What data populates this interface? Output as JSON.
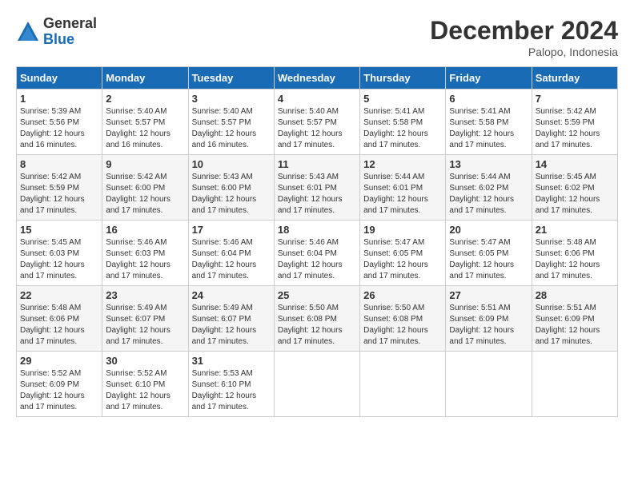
{
  "header": {
    "logo_general": "General",
    "logo_blue": "Blue",
    "month_title": "December 2024",
    "subtitle": "Palopo, Indonesia"
  },
  "days_of_week": [
    "Sunday",
    "Monday",
    "Tuesday",
    "Wednesday",
    "Thursday",
    "Friday",
    "Saturday"
  ],
  "weeks": [
    [
      {
        "day": "1",
        "sunrise": "5:39 AM",
        "sunset": "5:56 PM",
        "daylight": "12 hours and 16 minutes."
      },
      {
        "day": "2",
        "sunrise": "5:40 AM",
        "sunset": "5:57 PM",
        "daylight": "12 hours and 16 minutes."
      },
      {
        "day": "3",
        "sunrise": "5:40 AM",
        "sunset": "5:57 PM",
        "daylight": "12 hours and 16 minutes."
      },
      {
        "day": "4",
        "sunrise": "5:40 AM",
        "sunset": "5:57 PM",
        "daylight": "12 hours and 17 minutes."
      },
      {
        "day": "5",
        "sunrise": "5:41 AM",
        "sunset": "5:58 PM",
        "daylight": "12 hours and 17 minutes."
      },
      {
        "day": "6",
        "sunrise": "5:41 AM",
        "sunset": "5:58 PM",
        "daylight": "12 hours and 17 minutes."
      },
      {
        "day": "7",
        "sunrise": "5:42 AM",
        "sunset": "5:59 PM",
        "daylight": "12 hours and 17 minutes."
      }
    ],
    [
      {
        "day": "8",
        "sunrise": "5:42 AM",
        "sunset": "5:59 PM",
        "daylight": "12 hours and 17 minutes."
      },
      {
        "day": "9",
        "sunrise": "5:42 AM",
        "sunset": "6:00 PM",
        "daylight": "12 hours and 17 minutes."
      },
      {
        "day": "10",
        "sunrise": "5:43 AM",
        "sunset": "6:00 PM",
        "daylight": "12 hours and 17 minutes."
      },
      {
        "day": "11",
        "sunrise": "5:43 AM",
        "sunset": "6:01 PM",
        "daylight": "12 hours and 17 minutes."
      },
      {
        "day": "12",
        "sunrise": "5:44 AM",
        "sunset": "6:01 PM",
        "daylight": "12 hours and 17 minutes."
      },
      {
        "day": "13",
        "sunrise": "5:44 AM",
        "sunset": "6:02 PM",
        "daylight": "12 hours and 17 minutes."
      },
      {
        "day": "14",
        "sunrise": "5:45 AM",
        "sunset": "6:02 PM",
        "daylight": "12 hours and 17 minutes."
      }
    ],
    [
      {
        "day": "15",
        "sunrise": "5:45 AM",
        "sunset": "6:03 PM",
        "daylight": "12 hours and 17 minutes."
      },
      {
        "day": "16",
        "sunrise": "5:46 AM",
        "sunset": "6:03 PM",
        "daylight": "12 hours and 17 minutes."
      },
      {
        "day": "17",
        "sunrise": "5:46 AM",
        "sunset": "6:04 PM",
        "daylight": "12 hours and 17 minutes."
      },
      {
        "day": "18",
        "sunrise": "5:46 AM",
        "sunset": "6:04 PM",
        "daylight": "12 hours and 17 minutes."
      },
      {
        "day": "19",
        "sunrise": "5:47 AM",
        "sunset": "6:05 PM",
        "daylight": "12 hours and 17 minutes."
      },
      {
        "day": "20",
        "sunrise": "5:47 AM",
        "sunset": "6:05 PM",
        "daylight": "12 hours and 17 minutes."
      },
      {
        "day": "21",
        "sunrise": "5:48 AM",
        "sunset": "6:06 PM",
        "daylight": "12 hours and 17 minutes."
      }
    ],
    [
      {
        "day": "22",
        "sunrise": "5:48 AM",
        "sunset": "6:06 PM",
        "daylight": "12 hours and 17 minutes."
      },
      {
        "day": "23",
        "sunrise": "5:49 AM",
        "sunset": "6:07 PM",
        "daylight": "12 hours and 17 minutes."
      },
      {
        "day": "24",
        "sunrise": "5:49 AM",
        "sunset": "6:07 PM",
        "daylight": "12 hours and 17 minutes."
      },
      {
        "day": "25",
        "sunrise": "5:50 AM",
        "sunset": "6:08 PM",
        "daylight": "12 hours and 17 minutes."
      },
      {
        "day": "26",
        "sunrise": "5:50 AM",
        "sunset": "6:08 PM",
        "daylight": "12 hours and 17 minutes."
      },
      {
        "day": "27",
        "sunrise": "5:51 AM",
        "sunset": "6:09 PM",
        "daylight": "12 hours and 17 minutes."
      },
      {
        "day": "28",
        "sunrise": "5:51 AM",
        "sunset": "6:09 PM",
        "daylight": "12 hours and 17 minutes."
      }
    ],
    [
      {
        "day": "29",
        "sunrise": "5:52 AM",
        "sunset": "6:09 PM",
        "daylight": "12 hours and 17 minutes."
      },
      {
        "day": "30",
        "sunrise": "5:52 AM",
        "sunset": "6:10 PM",
        "daylight": "12 hours and 17 minutes."
      },
      {
        "day": "31",
        "sunrise": "5:53 AM",
        "sunset": "6:10 PM",
        "daylight": "12 hours and 17 minutes."
      },
      null,
      null,
      null,
      null
    ]
  ]
}
